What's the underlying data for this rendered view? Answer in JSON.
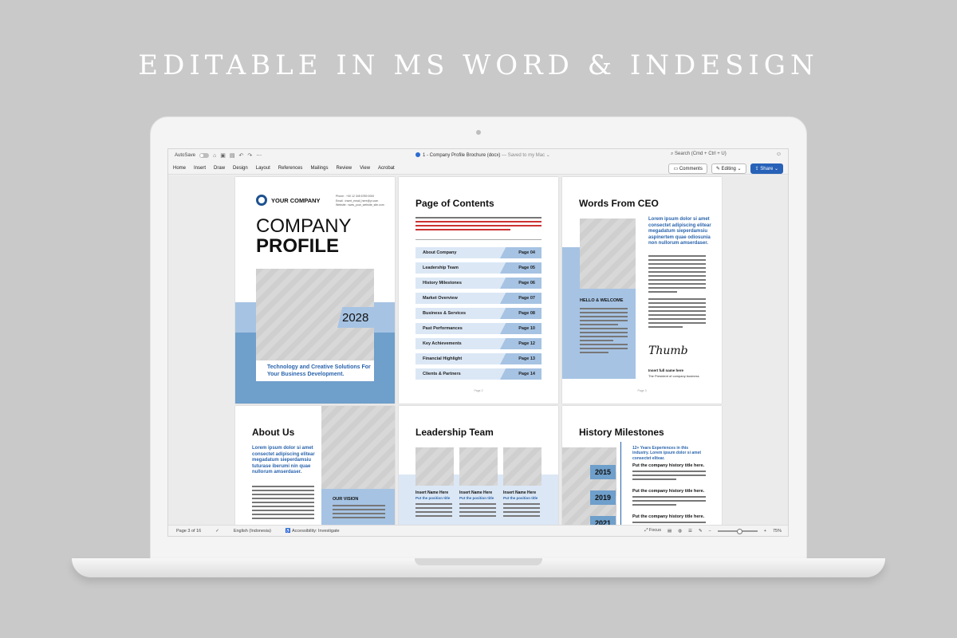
{
  "headline": "EDITABLE IN MS WORD & INDESIGN",
  "titlebar": {
    "autosave": "AutoSave",
    "doc_title": "1 - Company Profile Brochure (docx)",
    "saved_status": "— Saved to my Mac ⌄",
    "search_placeholder": "Search (Cmd + Ctrl + U)"
  },
  "ribbon": {
    "tabs": [
      "Home",
      "Insert",
      "Draw",
      "Design",
      "Layout",
      "References",
      "Mailings",
      "Review",
      "View",
      "Acrobat"
    ],
    "comments_label": "Comments",
    "editing_label": "Editing ⌄",
    "share_label": "Share ⌄"
  },
  "status": {
    "page": "Page 3 of 16",
    "language": "English (Indonesia)",
    "accessibility": "Accessibility: Investigate",
    "focus": "Focus",
    "zoom": "75%",
    "zoom_minus": "−",
    "zoom_plus": "+"
  },
  "cover": {
    "company": "YOUR COMPANY",
    "contact": [
      "Phone : +00 12 345 6789 0000",
      "Email : insert_email_here@yr.com",
      "Website : www_your_website_site.com"
    ],
    "title_line1": "COMPANY",
    "title_line2": "PROFILE",
    "year": "2028",
    "tagline": "Technology and Creative Solutions For Your Business Development."
  },
  "toc": {
    "title": "Page of Contents",
    "items": [
      {
        "label": "About Company",
        "page": "Page 04"
      },
      {
        "label": "Leadership Team",
        "page": "Page 05"
      },
      {
        "label": "History Milestones",
        "page": "Page 06"
      },
      {
        "label": "Market Overview",
        "page": "Page 07"
      },
      {
        "label": "Business & Services",
        "page": "Page 08"
      },
      {
        "label": "Past Performances",
        "page": "Page 10"
      },
      {
        "label": "Key Achievements",
        "page": "Page 12"
      },
      {
        "label": "Financial Highlight",
        "page": "Page 13"
      },
      {
        "label": "Clients & Partners",
        "page": "Page 14"
      }
    ],
    "page_label": "Page 2"
  },
  "ceo": {
    "title": "Words From CEO",
    "lead": "Lorem ipsum dolor si amet consectet adipiscing elitear megadatum sieperdamsiu aspinertem quae odiosunia non nullorum amserdaser.",
    "hello": "HELLO & WELCOME",
    "signature": "Thumb",
    "name": "Insert full name here",
    "position": "The President of company business",
    "page_label": "Page 3"
  },
  "about": {
    "title": "About Us",
    "lead": "Lorem ipsum dolor si amet consectet adipiscing elitear megadatum sieperdamsiu tuturase iberumi nin quae nullorum amserdaser.",
    "vision": "OUR VISION"
  },
  "leadership": {
    "title": "Leadership Team",
    "members": [
      {
        "name": "Insert Name Here",
        "position": "Put the position title"
      },
      {
        "name": "Insert Name Here",
        "position": "Put the position title"
      },
      {
        "name": "Insert Name Here",
        "position": "Put the position title"
      }
    ]
  },
  "history": {
    "title": "History Milestones",
    "lead": "12+ Years Experiences in this industry. Lorem ipsum dolor si amet consectet elitear.",
    "entries": [
      {
        "year": "2015",
        "heading": "Put the company history title here."
      },
      {
        "year": "2019",
        "heading": "Put the company history title here."
      },
      {
        "year": "2021",
        "heading": "Put the company history title here."
      }
    ]
  }
}
